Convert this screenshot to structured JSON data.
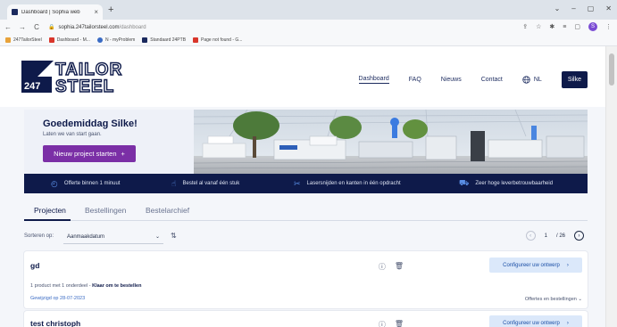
{
  "browser": {
    "tab_title": "Dashboard | Sophia web",
    "tab_close": "×",
    "new_tab": "+",
    "window_controls": [
      "⌄",
      "–",
      "▢",
      "✕"
    ],
    "url_host": "sophia.247tailorsteel.com",
    "url_path": "/dashboard",
    "nav": [
      "←",
      "→",
      "C"
    ],
    "bookmarks": [
      {
        "label": "247TailorSteel",
        "color": "#e8a23a"
      },
      {
        "label": "Dashboard - M...",
        "color": "#d9362b"
      },
      {
        "label": "N - myProblem",
        "color": "#3a6bc4"
      },
      {
        "label": "Standaard 24PTB",
        "color": "#1b2a5e"
      },
      {
        "label": "Page not found - G...",
        "color": "#d9362b"
      }
    ],
    "avatar_letter": "S"
  },
  "header": {
    "logo_top": "TAILOR",
    "logo_bottom": "STEEL",
    "logo_badge": "247",
    "nav": [
      {
        "label": "Dashboard",
        "active": true
      },
      {
        "label": "FAQ",
        "active": false
      },
      {
        "label": "Nieuws",
        "active": false
      },
      {
        "label": "Contact",
        "active": false
      }
    ],
    "language": "NL",
    "user": "Silke"
  },
  "hero": {
    "greeting": "Goedemiddag Silke!",
    "subtitle": "Laten we van start gaan.",
    "cta_label": "Nieuw project starten",
    "cta_icon": "+"
  },
  "usp": [
    {
      "label": "Offerte binnen 1 minuut",
      "icon": "clock-icon"
    },
    {
      "label": "Bestel al vanaf één stuk",
      "icon": "hand-icon"
    },
    {
      "label": "Lasersnijden en kanten in één opdracht",
      "icon": "laser-icon"
    },
    {
      "label": "Zeer hoge leverbetrouwbaarheid",
      "icon": "truck-icon"
    }
  ],
  "tabs": [
    {
      "label": "Projecten",
      "active": true
    },
    {
      "label": "Bestellingen",
      "active": false
    },
    {
      "label": "Bestelarchief",
      "active": false
    }
  ],
  "sort": {
    "label": "Sorteren op:",
    "value": "Aanmaakdatum",
    "chevron": "⌄",
    "sort_icon": "⇅"
  },
  "pager": {
    "prev": "‹",
    "current": "1",
    "total": "/ 26",
    "next": "›"
  },
  "projects": [
    {
      "name": "gd",
      "info_prefix": "1 product met 1 onderdeel - ",
      "status": "Klaar om te bestellen",
      "date": "Gewijzigd op 28-07-2023",
      "more": "Offertes en bestellingen ⌄",
      "cta": "Configureer uw ontwerp",
      "cta_arrow": "›"
    },
    {
      "name": "test christoph",
      "cta": "Configureer uw ontwerp",
      "cta_arrow": "›"
    }
  ]
}
